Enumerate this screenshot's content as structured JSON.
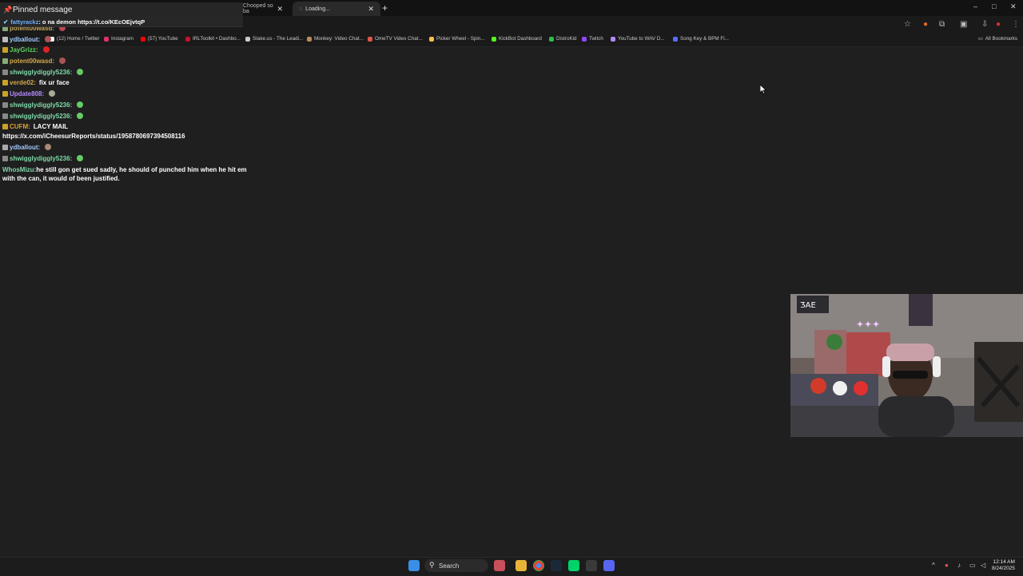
{
  "browser": {
    "tabs": [
      {
        "label": "Chooped so ba"
      },
      {
        "label": "Loading..."
      }
    ],
    "new_tab": "+",
    "window_controls": {
      "minimize": "–",
      "maximize": "□",
      "close": "✕"
    },
    "bookmarks": [
      {
        "label": "(12) Home / Twitter",
        "color": "#ffffff"
      },
      {
        "label": "Instagram",
        "color": "#e1306c"
      },
      {
        "label": "(57) YouTube",
        "color": "#ff0000"
      },
      {
        "label": "IRLToolkit • Dashbo...",
        "color": "#c8102e"
      },
      {
        "label": "Stake.us - The Leadi...",
        "color": "#cccccc"
      },
      {
        "label": "Monkey: Video Chat...",
        "color": "#b98a5a"
      },
      {
        "label": "OmeTV Video Chat...",
        "color": "#e0564b"
      },
      {
        "label": "Picker Wheel - Spin...",
        "color": "#f2c14e"
      },
      {
        "label": "KickBot Dashboard",
        "color": "#53fc18"
      },
      {
        "label": "DistroKid",
        "color": "#2fbf4a"
      },
      {
        "label": "Twitch",
        "color": "#9146ff"
      },
      {
        "label": "YouTube to WAV D...",
        "color": "#b388ff"
      },
      {
        "label": "Song Key & BPM Fi...",
        "color": "#5c6bff"
      }
    ],
    "all_bookmarks": "All Bookmarks"
  },
  "chat": {
    "pinned": {
      "title": "Pinned message",
      "user": "fattyrackz",
      "text": "o na demon https://t.co/KEcOEjvtqP"
    },
    "messages": [
      {
        "user": "potent00wasd:",
        "user_color": "#c8a85a",
        "text": ""
      },
      {
        "user": "ydballout:",
        "user_color": "#9ecbff",
        "text": ""
      },
      {
        "user": "JayGrizz:",
        "user_color": "#5ad25a",
        "text": ""
      },
      {
        "user": "potent00wasd:",
        "user_color": "#d4a94a",
        "text": ""
      },
      {
        "user": "shwigglydiggly5236:",
        "user_color": "#7fd8a8",
        "text": ""
      },
      {
        "user": "verde02:",
        "user_color": "#d4a94a",
        "text": "fix ur face"
      },
      {
        "user": "Update808:",
        "user_color": "#b48bff",
        "text": ""
      },
      {
        "user": "shwigglydiggly5236:",
        "user_color": "#7fd8a8",
        "text": ""
      },
      {
        "user": "shwigglydiggly5236:",
        "user_color": "#7fd8a8",
        "text": ""
      },
      {
        "user": "CUFM:",
        "user_color": "#e0a030",
        "text": "LACY MAIL"
      },
      {
        "user": "",
        "user_color": "#ffffff",
        "text": "https://x.com/iCheesurReports/status/1958780697394508116"
      },
      {
        "user": "ydballout:",
        "user_color": "#9ecbff",
        "text": ""
      },
      {
        "user": "shwigglydiggly5236:",
        "user_color": "#7fd8a8",
        "text": ""
      },
      {
        "user": "WhosMizu:",
        "user_color": "#7fd8a8",
        "text": "he still gon get sued sadly, he should of punched him when he hit em with the can, it would of been justified."
      }
    ]
  },
  "taskbar": {
    "search_label": "Search",
    "clock_time": "12:14 AM",
    "clock_date": "8/24/2025"
  }
}
